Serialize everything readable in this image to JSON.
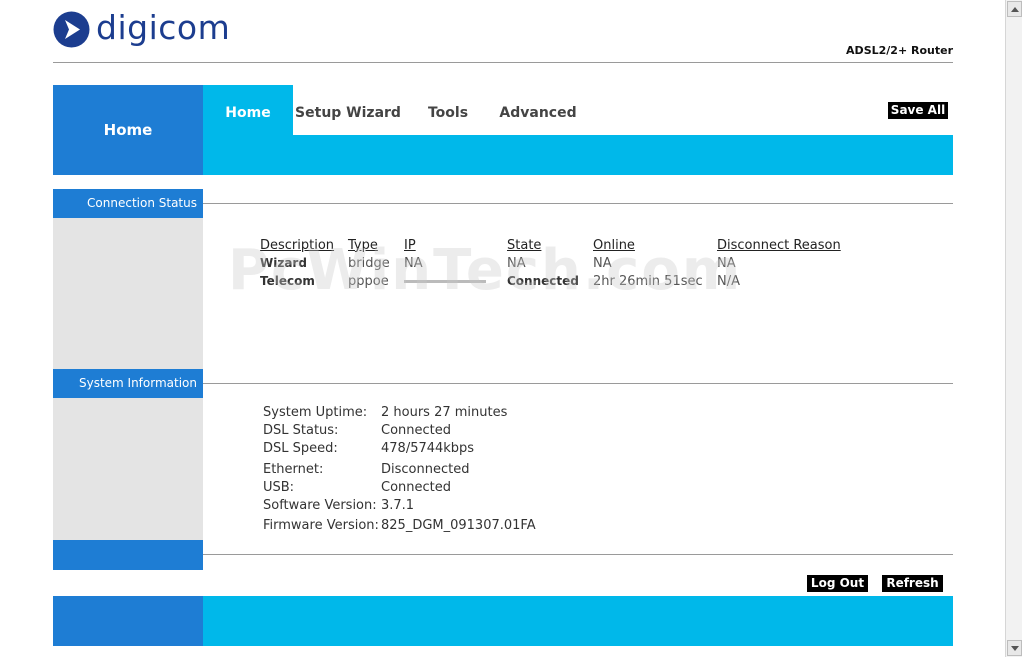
{
  "brand": {
    "name": "digicom",
    "model": "ADSL2/2+ Router",
    "logo_color": "#1c3d8f"
  },
  "nav": {
    "home_label": "Home",
    "tabs": [
      {
        "label": "Home",
        "active": true
      },
      {
        "label": "Setup Wizard",
        "active": false
      },
      {
        "label": "Tools",
        "active": false
      },
      {
        "label": "Advanced",
        "active": false
      }
    ],
    "save_all": "Save All"
  },
  "colors": {
    "primary_blue": "#1e7dd4",
    "cyan": "#00b8ea",
    "sidebar_grey": "#e4e4e4"
  },
  "connection_status": {
    "title": "Connection Status",
    "headers": [
      "Description",
      "Type",
      "IP",
      "State",
      "Online",
      "Disconnect Reason"
    ],
    "rows": [
      {
        "description": "Wizard",
        "type": "bridge",
        "ip": "NA",
        "state": "NA",
        "online": "NA",
        "reason": "NA"
      },
      {
        "description": "Telecom",
        "type": "pppoe",
        "ip": "",
        "state": "Connected",
        "online": "2hr 26min 51sec",
        "reason": "N/A"
      }
    ]
  },
  "system_information": {
    "title": "System Information",
    "rows": [
      {
        "label": "System Uptime:",
        "value": "2 hours 27 minutes"
      },
      {
        "label": "DSL Status:",
        "value": "Connected"
      },
      {
        "label": "DSL Speed:",
        "value": "478/5744kbps"
      },
      {
        "label": "Ethernet:",
        "value": "Disconnected"
      },
      {
        "label": "USB:",
        "value": "Connected"
      },
      {
        "label": "Software Version:",
        "value": "3.7.1"
      },
      {
        "label": "Firmware Version:",
        "value": "825_DGM_091307.01FA"
      }
    ]
  },
  "actions": {
    "logout": "Log Out",
    "refresh": "Refresh"
  },
  "watermark": "PcWinTech.com"
}
